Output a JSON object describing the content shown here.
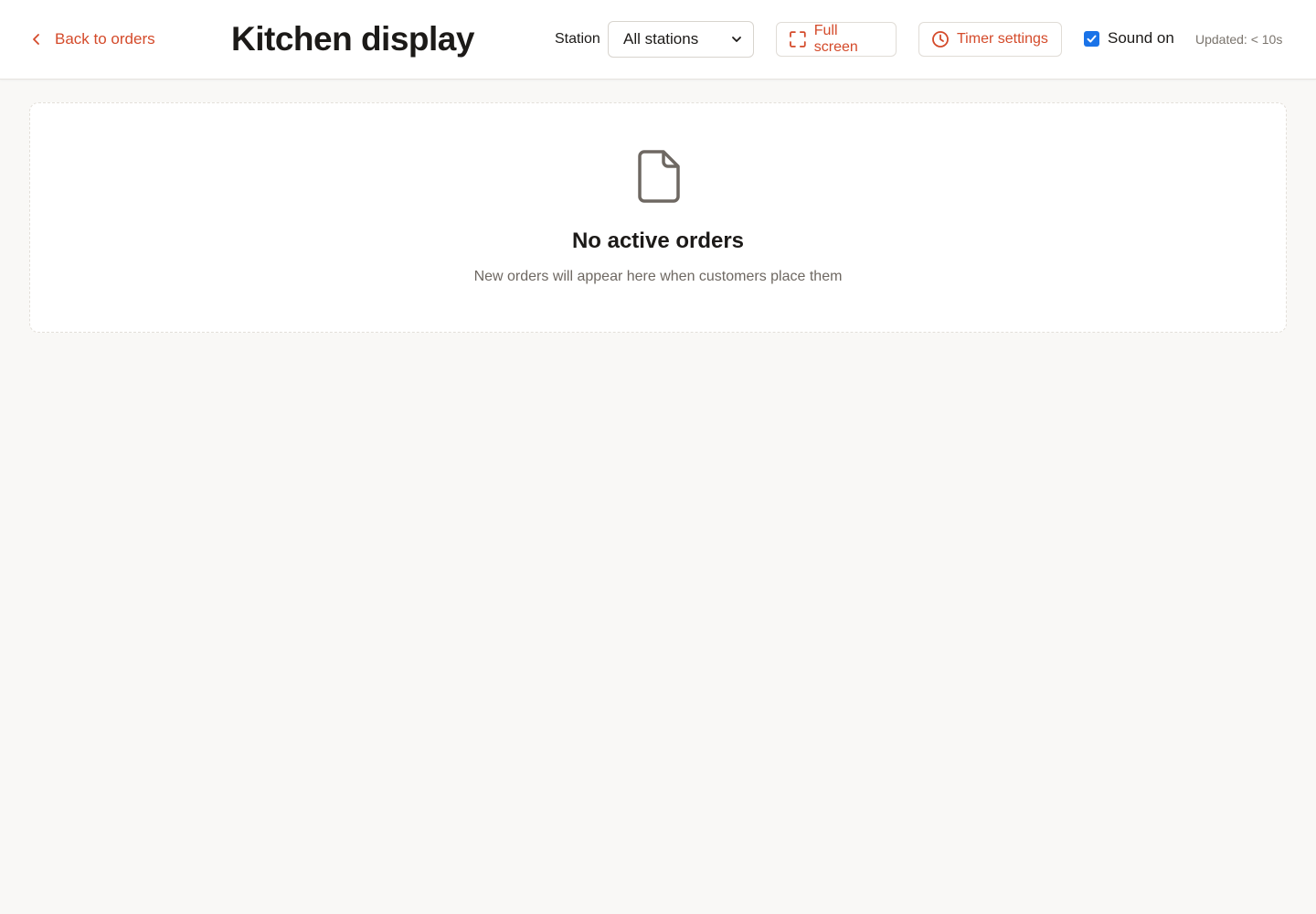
{
  "header": {
    "back_label": "Back to orders",
    "title": "Kitchen display",
    "station_label": "Station",
    "station_value": "All stations",
    "fullscreen_label": "Full screen",
    "timer_label": "Timer settings",
    "sound_label": "Sound on",
    "sound_checked": true,
    "updated_text": "Updated: < 10s"
  },
  "empty_state": {
    "icon": "document-icon",
    "title": "No active orders",
    "subtitle": "New orders will appear here when customers place them"
  },
  "colors": {
    "accent": "#d44a2a",
    "checkbox": "#1a73e8",
    "background": "#f9f8f6"
  }
}
